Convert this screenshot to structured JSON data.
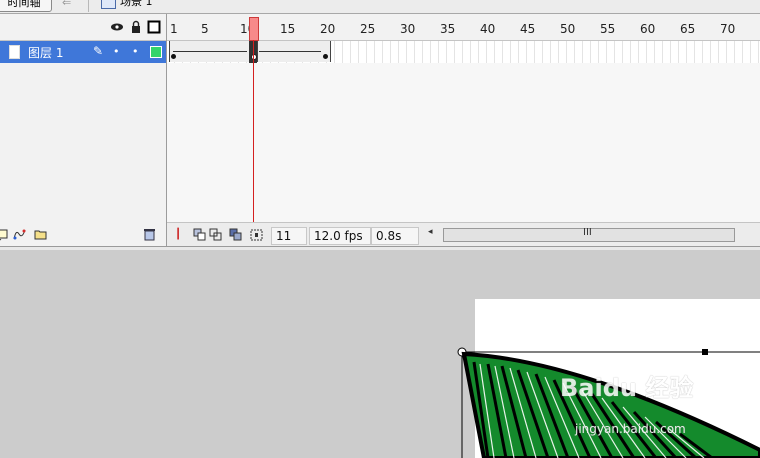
{
  "top_bar": {
    "timeline_tab": "时间轴",
    "back_arrow": "⇐",
    "scene_label": "场景 1"
  },
  "layers": {
    "header_icons": [
      "eye-icon",
      "lock-icon",
      "outline-icon"
    ],
    "layer_name": "图层 1",
    "layer_color": "#33d46b",
    "bottom_icons": [
      "insert-layer-icon",
      "add-motion-guide-icon",
      "insert-folder-icon",
      "delete-layer-icon"
    ]
  },
  "ruler": {
    "labels": [
      "1",
      "5",
      "10",
      "15",
      "20",
      "25",
      "30",
      "35",
      "40",
      "45",
      "50",
      "55",
      "60",
      "65",
      "70"
    ]
  },
  "timeline_status": {
    "current_frame": "11",
    "frame_rate": "12.0 fps",
    "elapsed_time": "0.8s",
    "scroll_grip": "III"
  },
  "stage": {
    "fill_color": "#148a2c",
    "watermark_brand": "Baidu 经验",
    "watermark_url": "jingyan.baidu.com"
  }
}
